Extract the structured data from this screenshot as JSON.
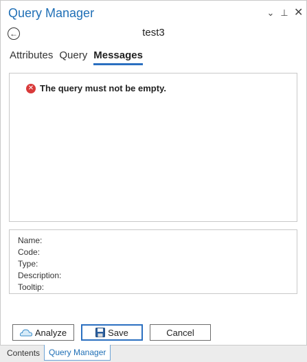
{
  "pane": {
    "title": "Query Manager",
    "controls": {
      "dropdown": "⌄",
      "pin": "⊥",
      "close": "✕"
    }
  },
  "header": {
    "back_icon": "back-arrow-circle-icon",
    "subject": "test3"
  },
  "tabs": [
    {
      "label": "Attributes",
      "active": false
    },
    {
      "label": "Query",
      "active": false
    },
    {
      "label": "Messages",
      "active": true
    }
  ],
  "messages": [
    {
      "icon": "error-icon",
      "text": "The query must not be empty."
    }
  ],
  "info": {
    "name_label": "Name:",
    "code_label": "Code:",
    "type_label": "Type:",
    "description_label": "Description:",
    "tooltip_label": "Tooltip:"
  },
  "buttons": {
    "analyze": "Analyze",
    "save": "Save",
    "cancel": "Cancel"
  },
  "bottom_tabs": [
    {
      "label": "Contents",
      "active": false
    },
    {
      "label": "Query Manager",
      "active": true
    }
  ],
  "colors": {
    "accent": "#1f6fb6",
    "tab_underline": "#2a6fc0",
    "error": "#d93a3a"
  }
}
